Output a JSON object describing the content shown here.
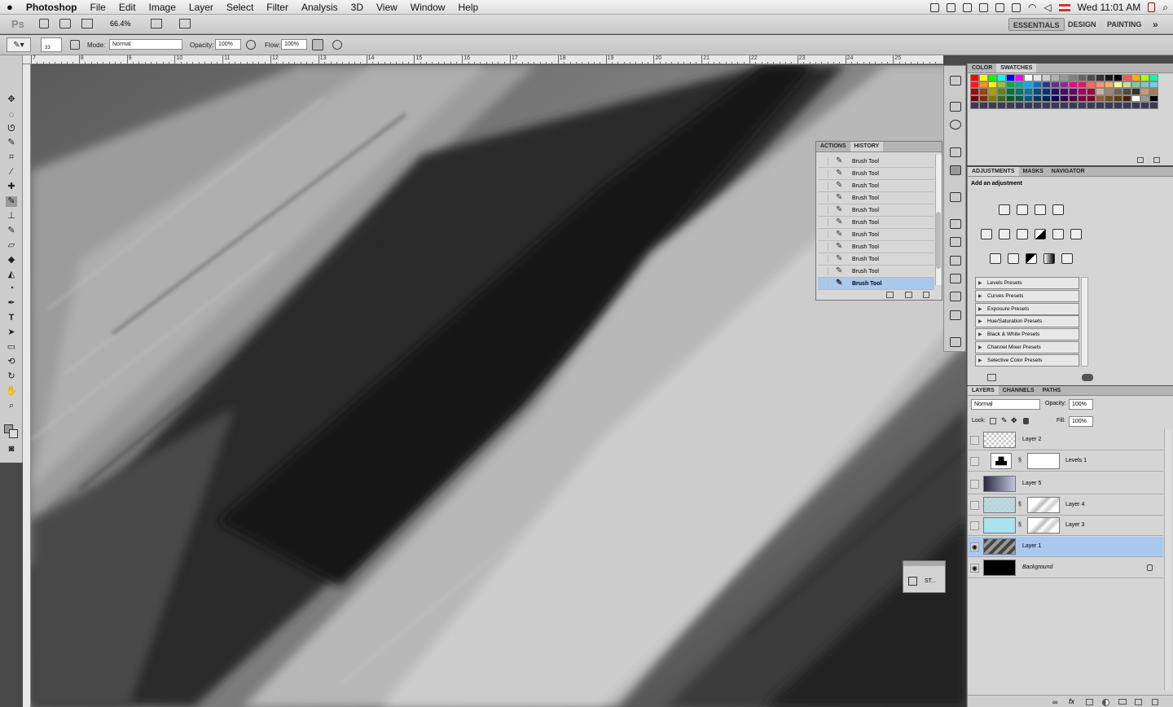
{
  "menubar": {
    "apple": "",
    "app": "Photoshop",
    "items": [
      "File",
      "Edit",
      "Image",
      "Layer",
      "Select",
      "Filter",
      "Analysis",
      "3D",
      "View",
      "Window",
      "Help"
    ],
    "clock": "Wed 11:01 AM"
  },
  "appbar": {
    "logo": "Ps",
    "zoom": "66.4%",
    "workspaces": [
      "ESSENTIALS",
      "DESIGN",
      "PAINTING"
    ],
    "more": "»"
  },
  "options": {
    "brush_size": "33",
    "mode_label": "Mode:",
    "mode_value": "Normal",
    "opacity_label": "Opacity:",
    "opacity_value": "100%",
    "flow_label": "Flow:",
    "flow_value": "100%"
  },
  "ruler": {
    "labels": [
      "7",
      "8",
      "9",
      "10",
      "11",
      "12",
      "13",
      "14",
      "15",
      "16",
      "17",
      "18",
      "19",
      "20",
      "21",
      "22",
      "23",
      "24",
      "25"
    ]
  },
  "color_panel": {
    "tabs": [
      "COLOR",
      "SWATCHES"
    ]
  },
  "history_panel": {
    "tabs": [
      "ACTIONS",
      "HISTORY"
    ],
    "items": [
      "Brush Tool",
      "Brush Tool",
      "Brush Tool",
      "Brush Tool",
      "Brush Tool",
      "Brush Tool",
      "Brush Tool",
      "Brush Tool",
      "Brush Tool",
      "Brush Tool",
      "Brush Tool"
    ],
    "selected_index": 10
  },
  "adjustments_panel": {
    "tabs": [
      "ADJUSTMENTS",
      "MASKS",
      "NAVIGATOR"
    ],
    "heading": "Add an adjustment",
    "presets": [
      "Levels Presets",
      "Curves Presets",
      "Exposure Presets",
      "Hue/Saturation Presets",
      "Black & White Presets",
      "Channel Mixer Presets",
      "Selective Color Presets"
    ]
  },
  "layers_panel": {
    "tabs": [
      "LAYERS",
      "CHANNELS",
      "PATHS"
    ],
    "blend_mode": "Normal",
    "opacity_label": "Opacity:",
    "opacity_value": "100%",
    "lock_label": "Lock:",
    "fill_label": "Fill:",
    "fill_value": "100%",
    "layers": [
      {
        "name": "Layer 2",
        "visible": false
      },
      {
        "name": "Levels 1",
        "visible": false
      },
      {
        "name": "Layer 5",
        "visible": false
      },
      {
        "name": "Layer 4",
        "visible": false
      },
      {
        "name": "Layer 3",
        "visible": false
      },
      {
        "name": "Layer 1",
        "visible": true,
        "selected": true
      },
      {
        "name": "Background",
        "visible": true,
        "locked": true
      }
    ]
  },
  "mini_panel": {
    "label": "ST..."
  },
  "colors": {
    "selection": "#a9c9ef",
    "panel_bg": "#d5d5d5"
  }
}
